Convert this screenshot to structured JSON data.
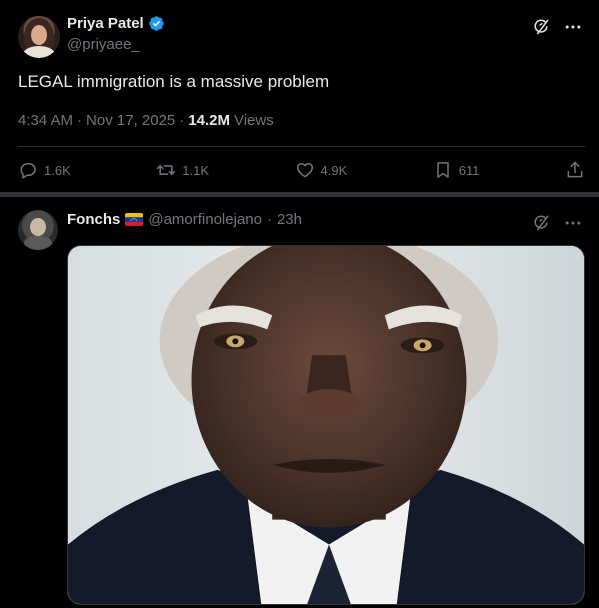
{
  "post": {
    "author_name": "Priya Patel",
    "author_handle": "@priyaee_",
    "text": "LEGAL immigration is a massive problem",
    "time": "4:34 AM",
    "dot1": "·",
    "date": "Nov 17, 2025",
    "dot2": "·",
    "views_count": "14.2M",
    "views_label": "Views",
    "actions": {
      "replies": "1.6K",
      "reposts": "1.1K",
      "likes": "4.9K",
      "bookmarks": "611"
    }
  },
  "reply": {
    "author_name": "Fonchs",
    "author_handle": "@amorfinolejano",
    "dot": "·",
    "time_ago": "23h"
  },
  "colors": {
    "background": "#000000",
    "text_primary": "#e7e9ea",
    "text_secondary": "#71767b",
    "divider": "#2f3336",
    "verified_blue": "#1d9bf0"
  },
  "icons": {
    "verified": "verified-badge-icon",
    "grok": "grok-icon",
    "more": "more-icon",
    "reply": "reply-icon",
    "repost": "repost-icon",
    "like": "like-icon",
    "bookmark": "bookmark-icon",
    "share": "share-icon",
    "flag": "venezuela-flag-icon"
  }
}
